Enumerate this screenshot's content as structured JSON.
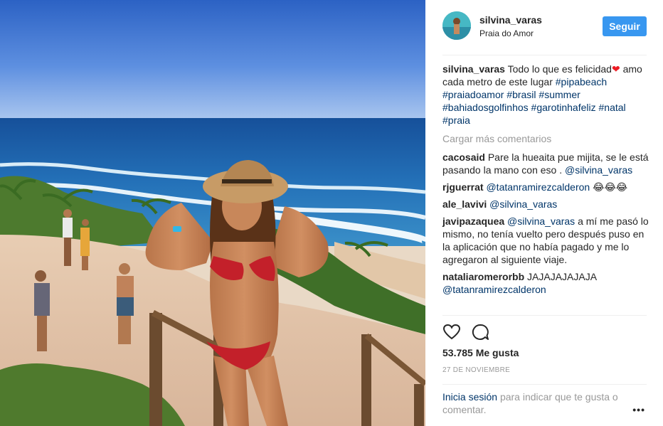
{
  "post": {
    "username": "silvina_varas",
    "location": "Praia do Amor",
    "follow_label": "Seguir"
  },
  "caption": {
    "user": "silvina_varas",
    "text": "Todo lo que es felicidad",
    "heart": "❤",
    "text2": "amo cada metro de este lugar",
    "tags": [
      "#pipabeach",
      "#praiadoamor",
      "#brasil",
      "#summer",
      "#bahiadosgolfinhos",
      "#garotinhafeliz",
      "#natal",
      "#praia"
    ]
  },
  "load_more": "Cargar más comentarios",
  "comments": [
    {
      "user": "cacosaid",
      "text": "Pare la hueaita pue mijita, se le está pasando la mano con eso .",
      "mention": "@silvina_varas"
    },
    {
      "user": "rjguerrat",
      "mention": "@tatanramirezcalderon",
      "text": "😂😂😂"
    },
    {
      "user": "ale_lavivi",
      "mention": "@silvina_varas"
    },
    {
      "user": "javipazaquea",
      "mention": "@silvina_varas",
      "text": "a mí me pasó lo mismo, no tenía vuelto pero después puso en la aplicación que no había pagado y me lo agregaron al siguiente viaje."
    },
    {
      "user": "nataliaromerorbb",
      "text": "JAJAJAJAJAJA",
      "mention": "@tatanramirezcalderon"
    }
  ],
  "likes": "53.785 Me gusta",
  "date": "27 DE NOVIEMBRE",
  "footer": {
    "login_label": "Inicia sesión",
    "text": "para indicar que te gusta o comentar.",
    "more": "•••"
  },
  "icons": {
    "like": "heart-icon",
    "comment": "comment-icon",
    "more": "more-options-icon"
  },
  "colors": {
    "follow_button": "#3897f0",
    "link": "#003569",
    "muted": "#999999"
  }
}
